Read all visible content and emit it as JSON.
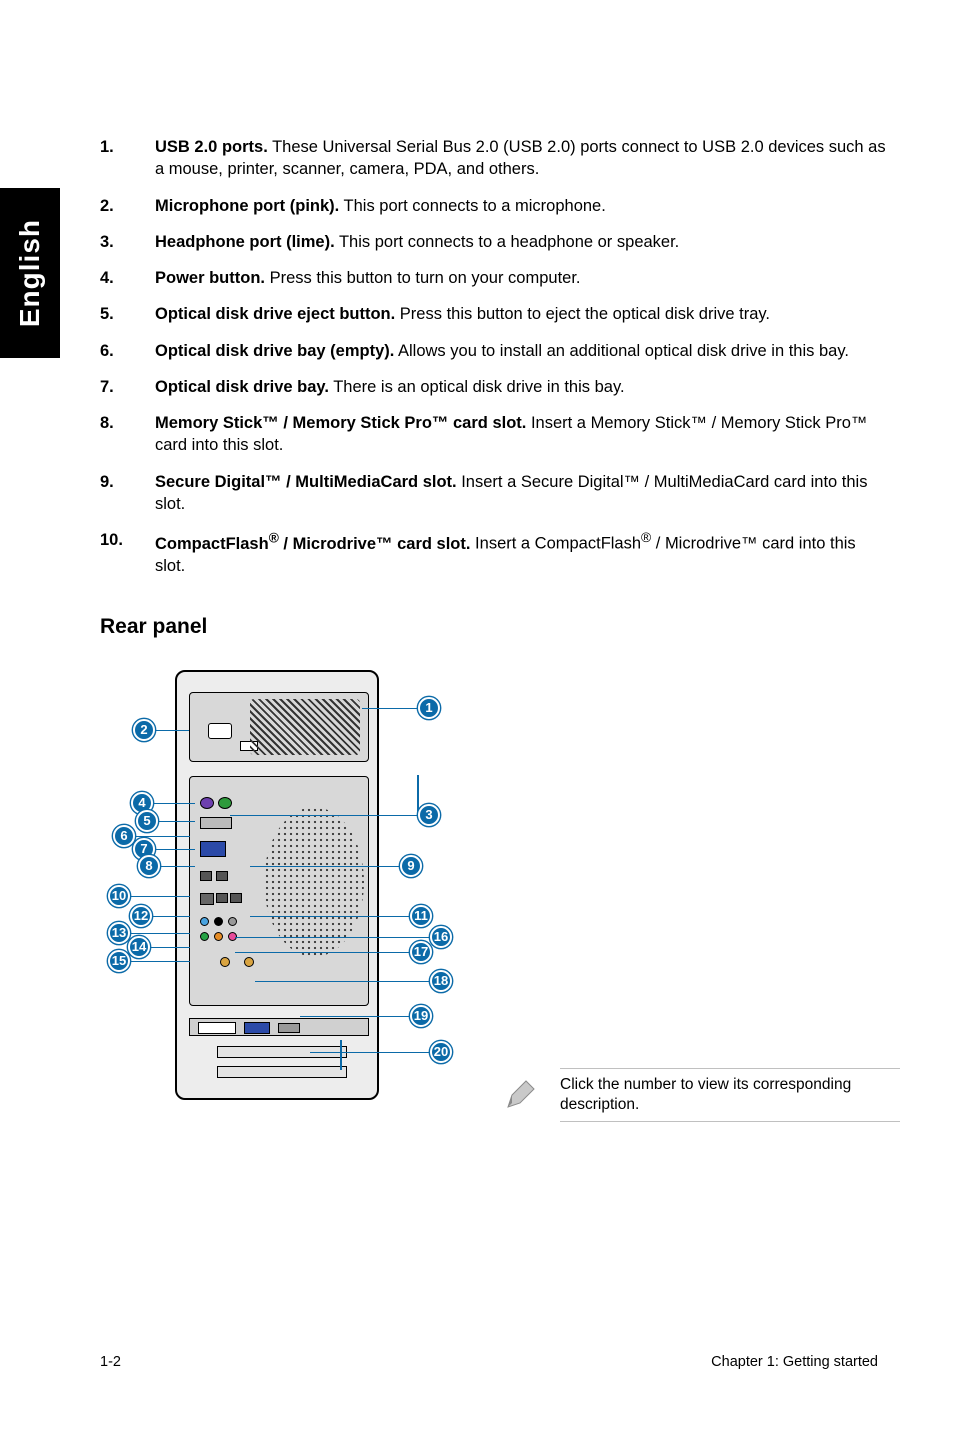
{
  "lang_tab": "English",
  "ports": [
    {
      "num": "1.",
      "bold": "USB 2.0 ports.",
      "rest": " These Universal Serial Bus 2.0 (USB 2.0) ports connect to USB 2.0 devices such as a mouse, printer, scanner, camera, PDA, and others."
    },
    {
      "num": "2.",
      "bold": "Microphone port (pink).",
      "rest": " This port connects to a microphone."
    },
    {
      "num": "3.",
      "bold": "Headphone port (lime).",
      "rest": " This port connects to a headphone or speaker."
    },
    {
      "num": "4.",
      "bold": "Power button.",
      "rest": " Press this button to turn on your computer."
    },
    {
      "num": "5.",
      "bold": "Optical disk drive eject button.",
      "rest": " Press this button to eject the optical disk drive tray."
    },
    {
      "num": "6.",
      "bold": "Optical disk drive bay (empty).",
      "rest": " Allows you to install an additional optical disk drive in this bay."
    },
    {
      "num": "7.",
      "bold": "Optical disk drive bay.",
      "rest": " There is an optical disk drive in this bay."
    },
    {
      "num": "8.",
      "bold": "Memory Stick™ / Memory Stick Pro™ card slot.",
      "rest": " Insert a Memory Stick™ / Memory Stick Pro™ card into this slot."
    },
    {
      "num": "9.",
      "bold": "Secure Digital™ / MultiMediaCard slot.",
      "rest": " Insert a Secure Digital™ / MultiMediaCard card into this slot."
    }
  ],
  "port10": {
    "num": "10.",
    "pre": "CompactFlash",
    "sup1": "®",
    "mid": " / Microdrive™ card slot.",
    "rest_pre": " Insert a CompactFlash",
    "sup2": "®",
    "rest_post": " / Microdrive™ card into this slot."
  },
  "rear_title": "Rear panel",
  "callouts": {
    "c1": "1",
    "c2": "2",
    "c3": "3",
    "c4": "4",
    "c5": "5",
    "c6": "6",
    "c7": "7",
    "c8": "8",
    "c9": "9",
    "c10": "10",
    "c11": "11",
    "c12": "12",
    "c13": "13",
    "c14": "14",
    "c15": "15",
    "c16": "16",
    "c17": "17",
    "c18": "18",
    "c19": "19",
    "c20": "20"
  },
  "note": "Click the number to view its corresponding description.",
  "footer_left": "1-2",
  "footer_right": "Chapter 1: Getting started"
}
